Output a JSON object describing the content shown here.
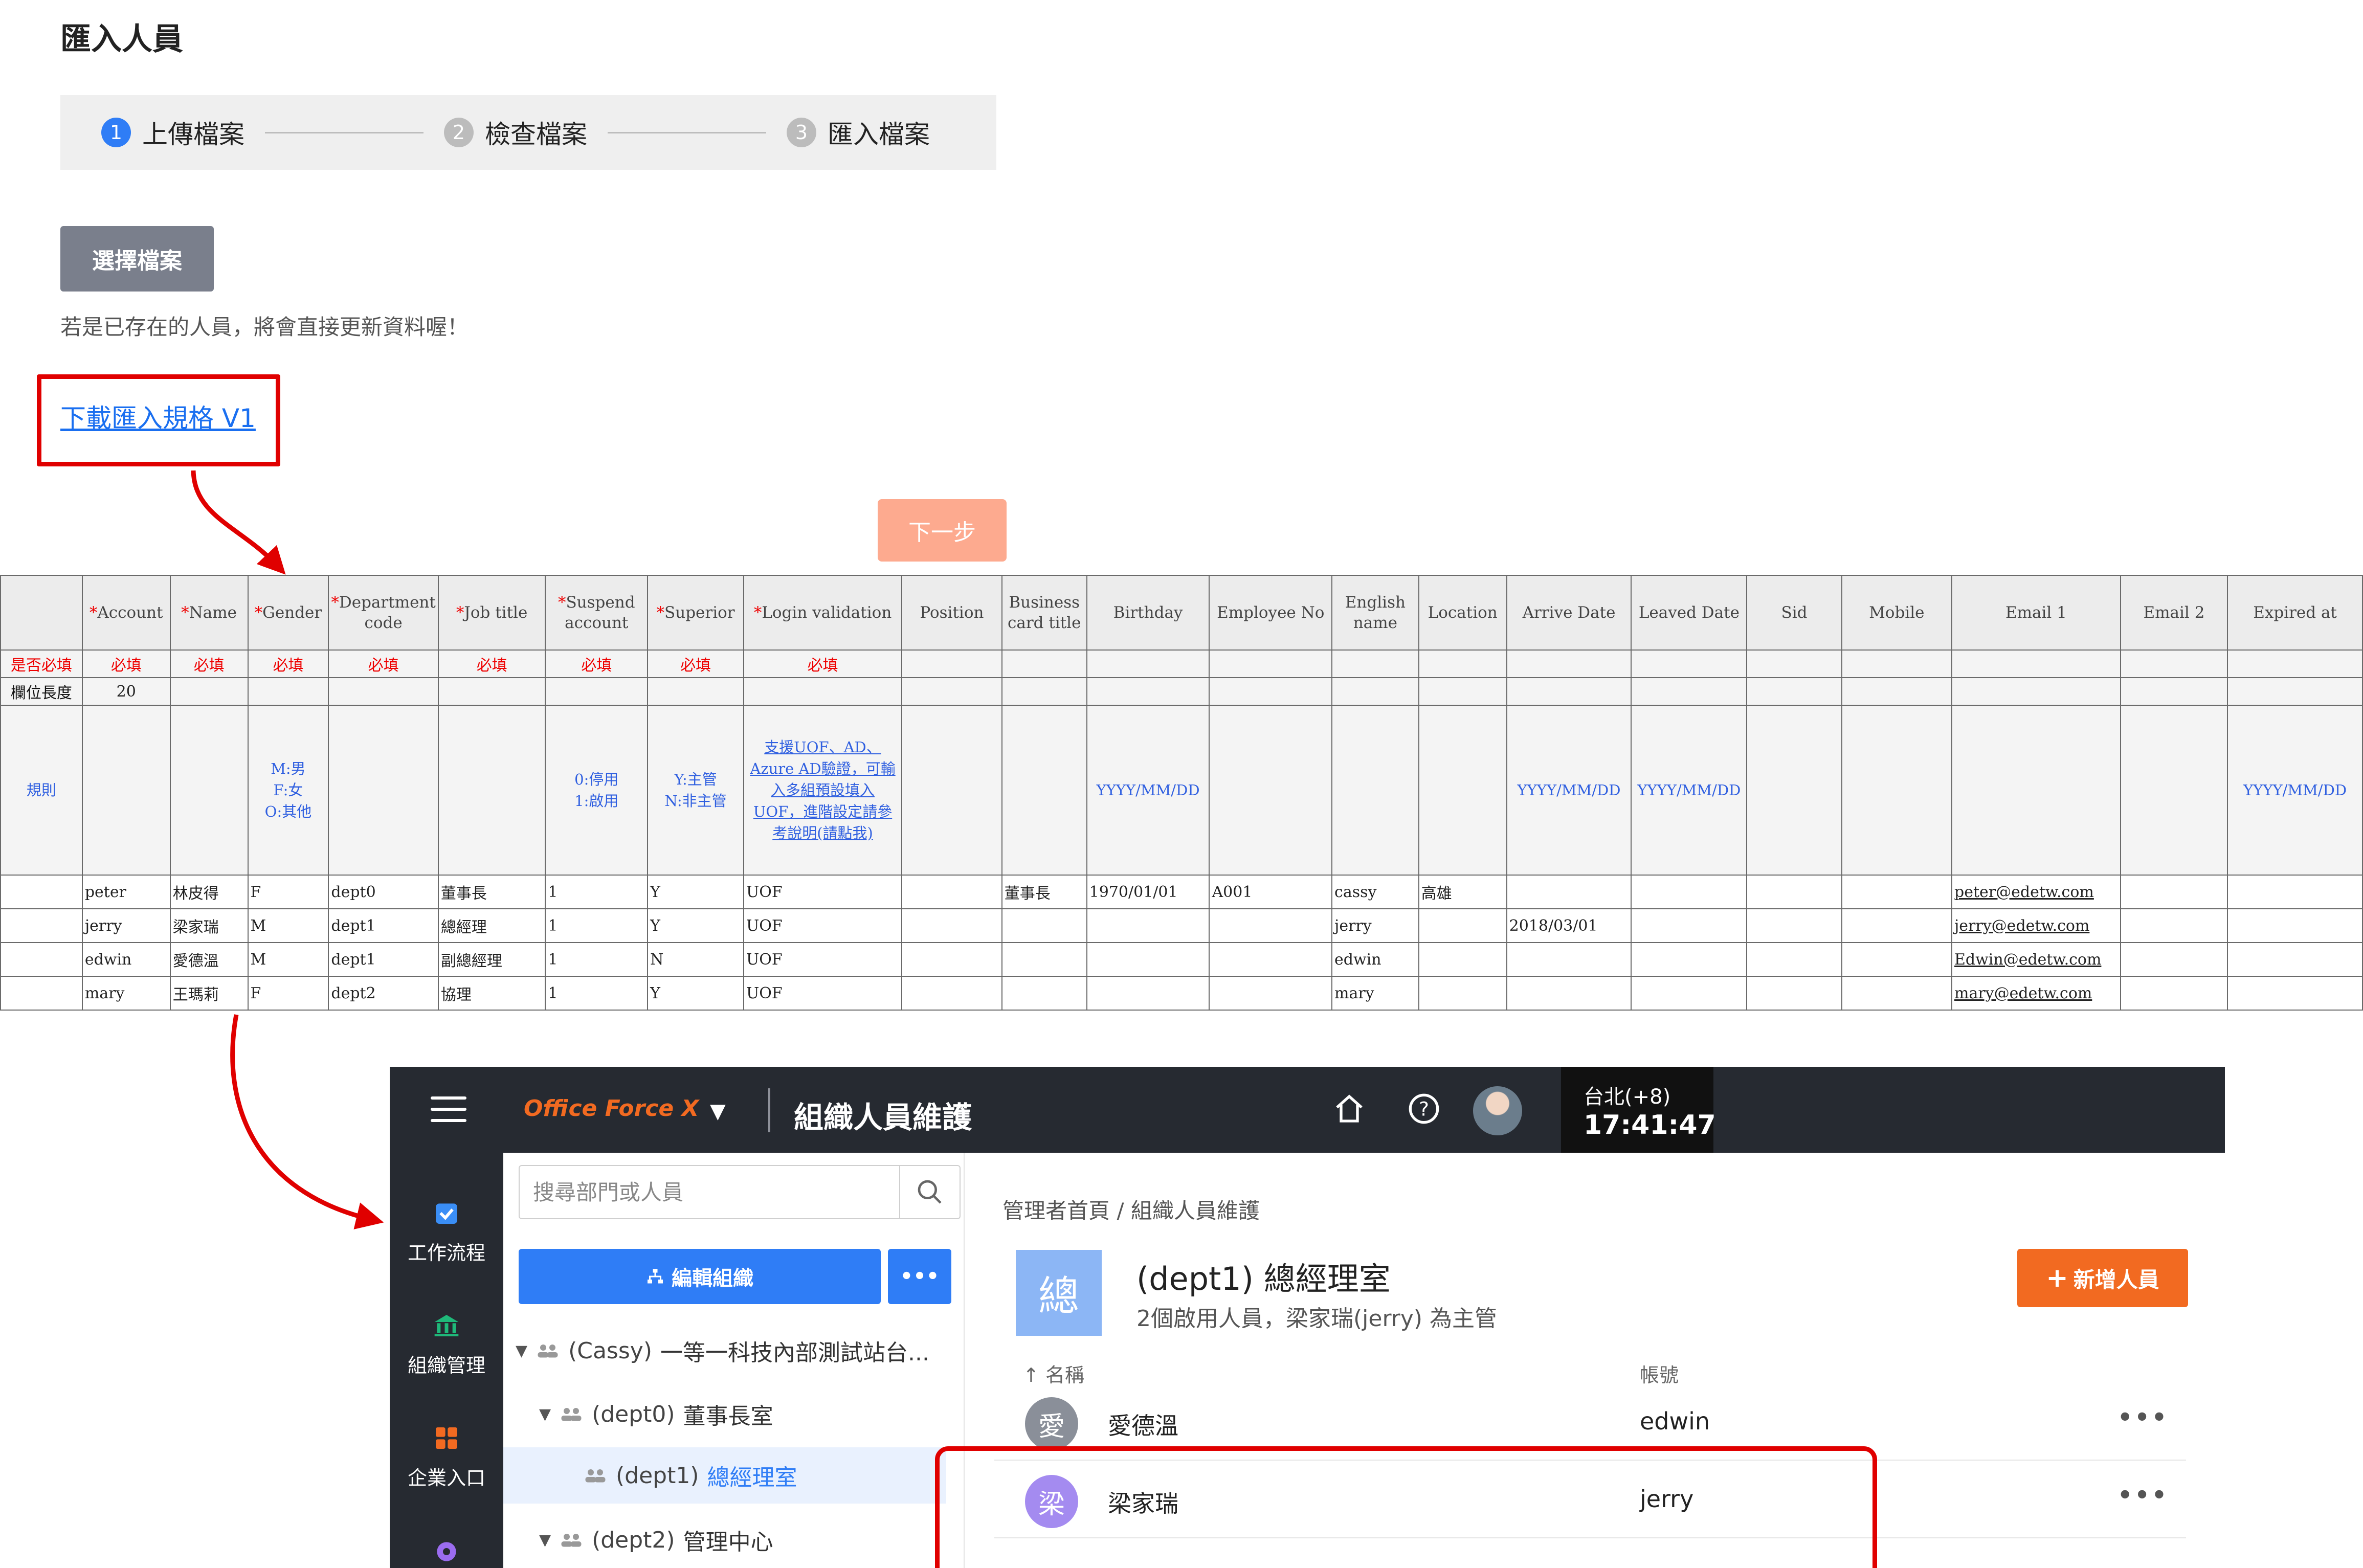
{
  "page": {
    "title": "匯入人員",
    "steps": [
      {
        "num": "1",
        "label": "上傳檔案"
      },
      {
        "num": "2",
        "label": "檢查檔案"
      },
      {
        "num": "3",
        "label": "匯入檔案"
      }
    ],
    "choose_file": "選擇檔案",
    "hint": "若是已存在的人員，將會直接更新資料喔！",
    "download_link": "下載匯入規格 V1",
    "next": "下一步"
  },
  "sheet": {
    "headers": [
      "",
      "*Account",
      "*Name",
      "*Gender",
      "*Department code",
      "*Job title",
      "*Suspend account",
      "*Superior",
      "*Login validation",
      "Position",
      "Business card title",
      "Birthday",
      "Employee No",
      "English name",
      "Location",
      "Arrive Date",
      "Leaved Date",
      "Sid",
      "Mobile",
      "Email 1",
      "Email 2",
      "Expired at"
    ],
    "required_row": [
      "是否必填",
      "必填",
      "必填",
      "必填",
      "必填",
      "必填",
      "必填",
      "必填",
      "必填",
      "",
      "",
      "",
      "",
      "",
      "",
      "",
      "",
      "",
      "",
      "",
      "",
      ""
    ],
    "length_row": [
      "欄位長度",
      "20",
      "",
      "",
      "",
      "",
      "",
      "",
      "",
      "",
      "",
      "",
      "",
      "",
      "",
      "",
      "",
      "",
      "",
      "",
      "",
      ""
    ],
    "rules_row": [
      "規則",
      "",
      "",
      "M:男\nF:女\nO:其他",
      "",
      "",
      "0:停用\n1:啟用",
      "Y:主管\nN:非主管",
      "支援UOF、AD、Azure AD驗證，可輸入多組預設填入UOF，進階設定請參考說明(請點我)",
      "",
      "",
      "YYYY/MM/DD",
      "",
      "",
      "",
      "YYYY/MM/DD",
      "YYYY/MM/DD",
      "",
      "",
      "",
      "",
      "YYYY/MM/DD"
    ],
    "rows": [
      [
        "",
        "peter",
        "林皮得",
        "F",
        "dept0",
        "董事長",
        "1",
        "Y",
        "UOF",
        "",
        "董事長",
        "1970/01/01",
        "A001",
        "cassy",
        "高雄",
        "",
        "",
        "",
        "",
        "peter@edetw.com",
        "",
        ""
      ],
      [
        "",
        "jerry",
        "梁家瑞",
        "M",
        "dept1",
        "總經理",
        "1",
        "Y",
        "UOF",
        "",
        "",
        "",
        "",
        "jerry",
        "",
        "2018/03/01",
        "",
        "",
        "",
        "jerry@edetw.com",
        "",
        ""
      ],
      [
        "",
        "edwin",
        "愛德溫",
        "M",
        "dept1",
        "副總經理",
        "1",
        "N",
        "UOF",
        "",
        "",
        "",
        "",
        "edwin",
        "",
        "",
        "",
        "",
        "",
        "Edwin@edetw.com",
        "",
        ""
      ],
      [
        "",
        "mary",
        "王瑪莉",
        "F",
        "dept2",
        "協理",
        "1",
        "Y",
        "UOF",
        "",
        "",
        "",
        "",
        "mary",
        "",
        "",
        "",
        "",
        "",
        "mary@edetw.com",
        "",
        ""
      ]
    ]
  },
  "app": {
    "logo": "Office Force X",
    "title": "組織人員維護",
    "clock": {
      "tz": "台北(+8)",
      "time": "17:41:47"
    },
    "nav": [
      {
        "label": "工作流程",
        "icon": "workflow-check-icon"
      },
      {
        "label": "組織管理",
        "icon": "org-building-icon"
      },
      {
        "label": "企業入口",
        "icon": "portal-grid-icon"
      },
      {
        "label": "",
        "icon": "settings-gear-icon"
      }
    ],
    "search_placeholder": "搜尋部門或人員",
    "edit_org": "編輯組織",
    "more": "•••",
    "tree": [
      {
        "code": "(Cassy)",
        "name": "一等一科技內部測試站台...",
        "depth": 0,
        "open": true
      },
      {
        "code": "(dept0)",
        "name": "董事長室",
        "depth": 1,
        "open": true
      },
      {
        "code": "(dept1)",
        "name": "總經理室",
        "depth": 2,
        "open": false,
        "selected": true
      },
      {
        "code": "(dept2)",
        "name": "管理中心",
        "depth": 1,
        "open": true
      }
    ],
    "breadcrumb": "管理者首頁 / 組織人員維護",
    "dept_avatar": "總",
    "dept_title": "(dept1) 總經理室",
    "dept_sub": "2個啟用人員，梁家瑞(jerry) 為主管",
    "add_person": "新增人員",
    "col_name": "名稱",
    "col_account": "帳號",
    "members": [
      {
        "avatar": "愛",
        "name": "愛德溫",
        "account": "edwin",
        "color": "#8a8f99"
      },
      {
        "avatar": "梁",
        "name": "梁家瑞",
        "account": "jerry",
        "color": "#a48bf0"
      }
    ]
  },
  "colors": {
    "accent": "#2f7df6",
    "orange": "#f26a21",
    "annotation_red": "#e00000"
  }
}
